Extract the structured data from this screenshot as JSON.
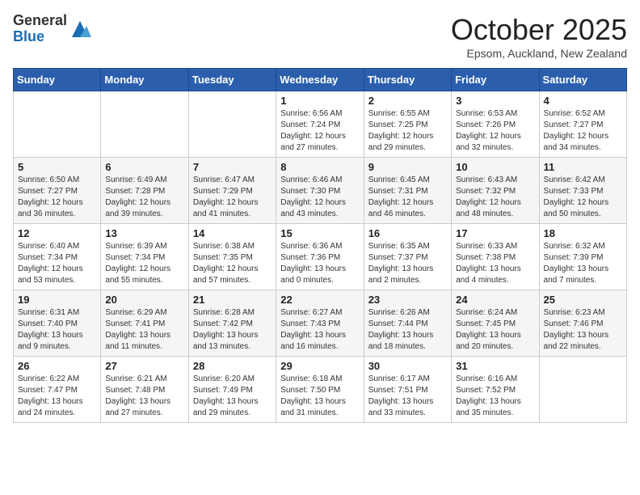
{
  "logo": {
    "general": "General",
    "blue": "Blue"
  },
  "header": {
    "month": "October 2025",
    "location": "Epsom, Auckland, New Zealand"
  },
  "weekdays": [
    "Sunday",
    "Monday",
    "Tuesday",
    "Wednesday",
    "Thursday",
    "Friday",
    "Saturday"
  ],
  "weeks": [
    [
      {
        "day": "",
        "info": ""
      },
      {
        "day": "",
        "info": ""
      },
      {
        "day": "",
        "info": ""
      },
      {
        "day": "1",
        "info": "Sunrise: 6:56 AM\nSunset: 7:24 PM\nDaylight: 12 hours\nand 27 minutes."
      },
      {
        "day": "2",
        "info": "Sunrise: 6:55 AM\nSunset: 7:25 PM\nDaylight: 12 hours\nand 29 minutes."
      },
      {
        "day": "3",
        "info": "Sunrise: 6:53 AM\nSunset: 7:26 PM\nDaylight: 12 hours\nand 32 minutes."
      },
      {
        "day": "4",
        "info": "Sunrise: 6:52 AM\nSunset: 7:27 PM\nDaylight: 12 hours\nand 34 minutes."
      }
    ],
    [
      {
        "day": "5",
        "info": "Sunrise: 6:50 AM\nSunset: 7:27 PM\nDaylight: 12 hours\nand 36 minutes."
      },
      {
        "day": "6",
        "info": "Sunrise: 6:49 AM\nSunset: 7:28 PM\nDaylight: 12 hours\nand 39 minutes."
      },
      {
        "day": "7",
        "info": "Sunrise: 6:47 AM\nSunset: 7:29 PM\nDaylight: 12 hours\nand 41 minutes."
      },
      {
        "day": "8",
        "info": "Sunrise: 6:46 AM\nSunset: 7:30 PM\nDaylight: 12 hours\nand 43 minutes."
      },
      {
        "day": "9",
        "info": "Sunrise: 6:45 AM\nSunset: 7:31 PM\nDaylight: 12 hours\nand 46 minutes."
      },
      {
        "day": "10",
        "info": "Sunrise: 6:43 AM\nSunset: 7:32 PM\nDaylight: 12 hours\nand 48 minutes."
      },
      {
        "day": "11",
        "info": "Sunrise: 6:42 AM\nSunset: 7:33 PM\nDaylight: 12 hours\nand 50 minutes."
      }
    ],
    [
      {
        "day": "12",
        "info": "Sunrise: 6:40 AM\nSunset: 7:34 PM\nDaylight: 12 hours\nand 53 minutes."
      },
      {
        "day": "13",
        "info": "Sunrise: 6:39 AM\nSunset: 7:34 PM\nDaylight: 12 hours\nand 55 minutes."
      },
      {
        "day": "14",
        "info": "Sunrise: 6:38 AM\nSunset: 7:35 PM\nDaylight: 12 hours\nand 57 minutes."
      },
      {
        "day": "15",
        "info": "Sunrise: 6:36 AM\nSunset: 7:36 PM\nDaylight: 13 hours\nand 0 minutes."
      },
      {
        "day": "16",
        "info": "Sunrise: 6:35 AM\nSunset: 7:37 PM\nDaylight: 13 hours\nand 2 minutes."
      },
      {
        "day": "17",
        "info": "Sunrise: 6:33 AM\nSunset: 7:38 PM\nDaylight: 13 hours\nand 4 minutes."
      },
      {
        "day": "18",
        "info": "Sunrise: 6:32 AM\nSunset: 7:39 PM\nDaylight: 13 hours\nand 7 minutes."
      }
    ],
    [
      {
        "day": "19",
        "info": "Sunrise: 6:31 AM\nSunset: 7:40 PM\nDaylight: 13 hours\nand 9 minutes."
      },
      {
        "day": "20",
        "info": "Sunrise: 6:29 AM\nSunset: 7:41 PM\nDaylight: 13 hours\nand 11 minutes."
      },
      {
        "day": "21",
        "info": "Sunrise: 6:28 AM\nSunset: 7:42 PM\nDaylight: 13 hours\nand 13 minutes."
      },
      {
        "day": "22",
        "info": "Sunrise: 6:27 AM\nSunset: 7:43 PM\nDaylight: 13 hours\nand 16 minutes."
      },
      {
        "day": "23",
        "info": "Sunrise: 6:26 AM\nSunset: 7:44 PM\nDaylight: 13 hours\nand 18 minutes."
      },
      {
        "day": "24",
        "info": "Sunrise: 6:24 AM\nSunset: 7:45 PM\nDaylight: 13 hours\nand 20 minutes."
      },
      {
        "day": "25",
        "info": "Sunrise: 6:23 AM\nSunset: 7:46 PM\nDaylight: 13 hours\nand 22 minutes."
      }
    ],
    [
      {
        "day": "26",
        "info": "Sunrise: 6:22 AM\nSunset: 7:47 PM\nDaylight: 13 hours\nand 24 minutes."
      },
      {
        "day": "27",
        "info": "Sunrise: 6:21 AM\nSunset: 7:48 PM\nDaylight: 13 hours\nand 27 minutes."
      },
      {
        "day": "28",
        "info": "Sunrise: 6:20 AM\nSunset: 7:49 PM\nDaylight: 13 hours\nand 29 minutes."
      },
      {
        "day": "29",
        "info": "Sunrise: 6:18 AM\nSunset: 7:50 PM\nDaylight: 13 hours\nand 31 minutes."
      },
      {
        "day": "30",
        "info": "Sunrise: 6:17 AM\nSunset: 7:51 PM\nDaylight: 13 hours\nand 33 minutes."
      },
      {
        "day": "31",
        "info": "Sunrise: 6:16 AM\nSunset: 7:52 PM\nDaylight: 13 hours\nand 35 minutes."
      },
      {
        "day": "",
        "info": ""
      }
    ]
  ]
}
